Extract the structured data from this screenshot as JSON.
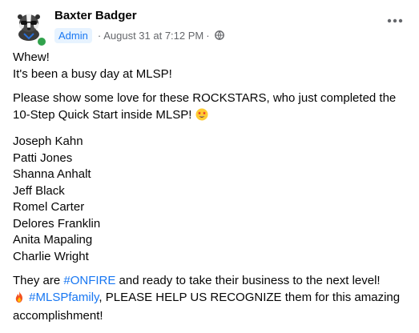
{
  "post": {
    "author": "Baxter Badger",
    "badge": "Admin",
    "sep1": "·",
    "timestamp": "August 31 at 7:12 PM",
    "sep2": "·",
    "privacy_icon": "globe-icon",
    "more_icon": "more-options-icon"
  },
  "body": {
    "line1": "Whew!",
    "line2": "It's been a busy day at MLSP!",
    "intro": "Please show some love for these ROCKSTARS, who just completed the 10-Step Quick Start inside MLSP!",
    "intro_emoji": "star-struck-emoji",
    "names": [
      "Joseph Kahn",
      "Patti Jones",
      "Shanna Anhalt",
      "Jeff Black",
      "Romel Carter",
      "Delores Franklin",
      "Anita Mapaling",
      "Charlie Wright"
    ],
    "closing_part1": "They are ",
    "hashtag1": "#ONFIRE",
    "closing_part2": " and ready to take their business to the next level!",
    "fire_emoji": "fire-emoji",
    "hashtag2": "#MLSPfamily",
    "closing_part3": ", PLEASE HELP US RECOGNIZE them for this amazing accomplishment!"
  },
  "colors": {
    "hashtag": "#1877f2",
    "meta": "#65676b",
    "online": "#31a24c"
  }
}
